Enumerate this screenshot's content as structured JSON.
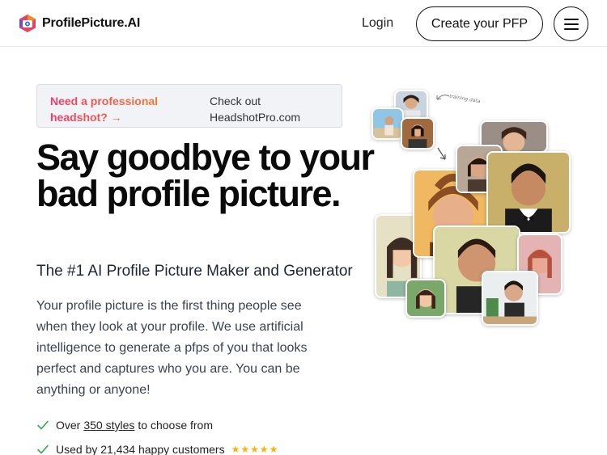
{
  "header": {
    "logo_text": "ProfilePicture.AI",
    "login_label": "Login",
    "create_label": "Create your PFP",
    "menu_icon": "hamburger-menu-icon"
  },
  "promo": {
    "left_text": "Need a professional headshot? →",
    "right_text": "Check out HeadshotPro.com"
  },
  "hero": {
    "title": "Say goodbye to your bad profile picture.",
    "subtitle": "The #1 AI Profile Picture Maker and Generator",
    "body": "Your profile picture is the first thing people see when they look at your profile. We use artificial intelligence to generate a pfps of you that looks perfect and captures who you are. You can be anything or anyone!"
  },
  "features": {
    "item1_prefix": "Over",
    "item1_link": "350 styles",
    "item1_suffix": "to choose from",
    "item2_text": "Used by 21,434 happy customers",
    "item2_stars": "★★★★★"
  },
  "collage": {
    "note": "training data"
  },
  "colors": {
    "accent_gradient_start": "#ef3b6a",
    "accent_gradient_end": "#f0822d",
    "check_green": "#2fa84f",
    "star_gold": "#f5b50a"
  }
}
